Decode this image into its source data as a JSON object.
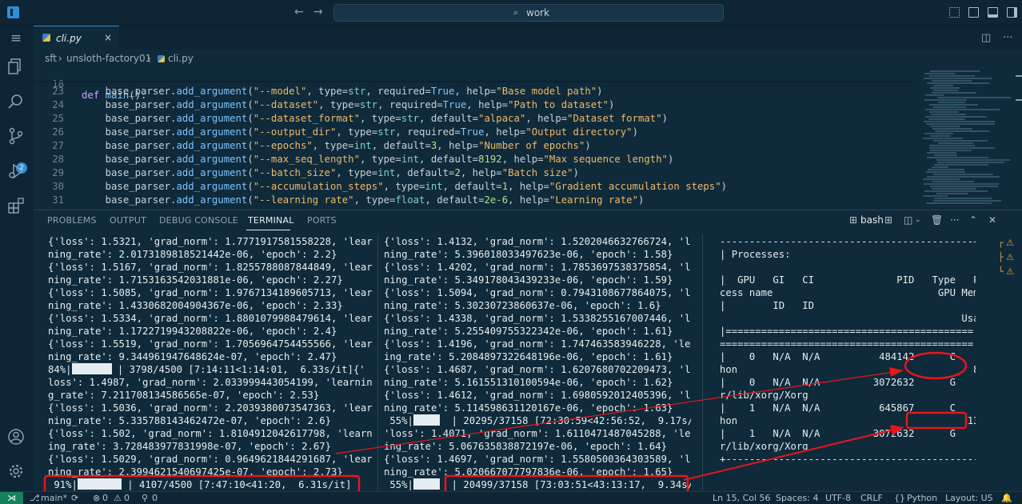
{
  "titlebar": {
    "search_text": "work",
    "back_glyph": "←",
    "forward_glyph": "→"
  },
  "activity": {
    "scm_badge": "2",
    "items": [
      "explorer-icon",
      "search-icon",
      "source-control-icon",
      "run-debug-icon",
      "extensions-icon",
      "account-icon",
      "settings-icon"
    ]
  },
  "editor": {
    "tab_label": "cli.py",
    "tab_close": "×",
    "breadcrumb": [
      "sft",
      "unsloth-factory01",
      "cli.py"
    ],
    "sticky_line": {
      "number": "18",
      "text": "def main():"
    },
    "lines": [
      {
        "n": "23",
        "arg": "--model",
        "type": "str",
        "mid": "required",
        "val": "True",
        "help": "Base model path"
      },
      {
        "n": "24",
        "arg": "--dataset",
        "type": "str",
        "mid": "required",
        "val": "True",
        "help": "Path to dataset"
      },
      {
        "n": "25",
        "arg": "--dataset_format",
        "type": "str",
        "mid": "default",
        "val": "\"alpaca\"",
        "help": "Dataset format"
      },
      {
        "n": "26",
        "arg": "--output_dir",
        "type": "str",
        "mid": "required",
        "val": "True",
        "help": "Output directory"
      },
      {
        "n": "27",
        "arg": "--epochs",
        "type": "int",
        "mid": "default",
        "val": "3",
        "help": "Number of epochs"
      },
      {
        "n": "28",
        "arg": "--max_seq_length",
        "type": "int",
        "mid": "default",
        "val": "8192",
        "help": "Max sequence length"
      },
      {
        "n": "29",
        "arg": "--batch_size",
        "type": "int",
        "mid": "default",
        "val": "2",
        "help": "Batch size"
      },
      {
        "n": "30",
        "arg": "--accumulation_steps",
        "type": "int",
        "mid": "default",
        "val": "1",
        "help": "Gradient accumulation steps"
      },
      {
        "n": "31",
        "arg": "--learning rate",
        "type": "float",
        "mid": "default",
        "val": "2e-6",
        "help": "Learning rate"
      }
    ]
  },
  "panel": {
    "tabs": [
      "PROBLEMS",
      "OUTPUT",
      "DEBUG CONSOLE",
      "TERMINAL",
      "PORTS"
    ],
    "active_tab": "TERMINAL",
    "shell": "bash",
    "terminal1": {
      "lines": [
        "{'loss': 1.5321, 'grad_norm': 1.7771917581558228, 'lear",
        "ning_rate': 2.0173189818521442e-06, 'epoch': 2.2}",
        "{'loss': 1.5167, 'grad_norm': 1.8255788087844849, 'lear",
        "ning_rate': 1.7153163542031881e-06, 'epoch': 2.27}",
        "{'loss': 1.5085, 'grad_norm': 1.9767134189605713, 'lear",
        "ning_rate': 1.4330682004904367e-06, 'epoch': 2.33}",
        "{'loss': 1.5334, 'grad_norm': 1.8801079988479614, 'lear",
        "ning_rate': 1.1722719943208822e-06, 'epoch': 2.4}",
        "{'loss': 1.5519, 'grad_norm': 1.7056964754455566, 'lear",
        "ning_rate': 9.344961947648624e-07, 'epoch': 2.47}",
        "__P84__",
        "loss': 1.4987, 'grad_norm': 2.033999443054199, 'learnin",
        "g_rate': 7.211708134586565e-07, 'epoch': 2.53}",
        "{'loss': 1.5036, 'grad_norm': 2.2039380073547363, 'lear",
        "ning_rate': 5.335788143462472e-07, 'epoch': 2.6}",
        "{'loss': 1.502, 'grad_norm': 1.8104912042617798, 'learn",
        "ing_rate': 3.728483977831998e-07, 'epoch': 2.67}",
        "{'loss': 1.5029, 'grad_norm': 0.9649621844291687, 'lear",
        "ning_rate': 2.3994621540697425e-07, 'epoch': 2.73}",
        "__P91__"
      ],
      "progress_84": {
        "pct": "84%|",
        "fill": 0.84,
        "rest": " | 3798/4500 [7:14:11<1:14:01,  6.33s/it]{'"
      },
      "progress_91": {
        "pct": " 91%|",
        "fill": 0.91,
        "rest": " | 4107/4500 [7:47:10<41:20,  6.31s/it]"
      }
    },
    "terminal2": {
      "lines": [
        "{'loss': 1.4132, 'grad_norm': 1.5202046632766724, 'lear",
        "ning_rate': 5.396018033497623e-06, 'epoch': 1.58}",
        "{'loss': 1.4202, 'grad_norm': 1.7853697538375854, 'lear",
        "ning_rate': 5.349178043439233e-06, 'epoch': 1.59}",
        "{'loss': 1.5094, 'grad_norm': 0.7943108677864075, 'lear",
        "ning_rate': 5.30230723860637e-06, 'epoch': 1.6}",
        "{'loss': 1.4338, 'grad_norm': 1.5338255167007446, 'lear",
        "ning_rate': 5.255409755322342e-06, 'epoch': 1.61}",
        "{'loss': 1.4196, 'grad_norm': 1.747463583946228, 'learn",
        "ing_rate': 5.2084897322648196e-06, 'epoch': 1.61}",
        "{'loss': 1.4687, 'grad_norm': 1.6207680702209473, 'lear",
        "ning_rate': 5.161551310100594e-06, 'epoch': 1.62}",
        "{'loss': 1.4612, 'grad_norm': 1.6980592012405396, 'lear",
        "ning_rate': 5.114598631120167e-06, 'epoch': 1.63}",
        "__P55a__",
        "'loss': 1.4071, 'grad_norm': 1.6110471487045288, 'learn",
        "ing_rate': 5.067635838872197e-06, 'epoch': 1.64}",
        "{'loss': 1.4697, 'grad_norm': 1.5580500364303589, 'lear",
        "ning_rate': 5.020667077797836e-06, 'epoch': 1.65}",
        "__P55b__"
      ],
      "progress_55a": {
        "pct": " 55%|",
        "fill": 0.55,
        "rest": "  | 20295/37158 [72:30:59<42:56:52,  9.17s/it]{"
      },
      "progress_55b": {
        "pct": " 55%|",
        "fill": 0.55,
        "rest": "  | 20499/37158 [73:03:51<43:13:17,  9.34s/it]"
      }
    },
    "terminal3": {
      "lines": [
        "-------------------------------------------+",
        "| Processes:",
        "                                           |",
        "|  GPU   GI   CI              PID   Type   Pro",
        "cess name                            GPU Memory |",
        "|        ID   ID",
        "                                         Usage      |",
        "|==========================================",
        "===========================================|",
        "|    0   N/A  N/A          484142      C    pyt",
        "hon                                        8374MiB |",
        "|    0   N/A  N/A         3072632      G    /us",
        "r/lib/xorg/Xorg                              4MiB |",
        "|    1   N/A  N/A          645867      C    pyt",
        "hon                                       13838MiB |",
        "|    1   N/A  N/A         3072632      G    /us",
        "r/lib/xorg/Xorg                              4MiB |",
        "+-------------------------------------------+"
      ]
    }
  },
  "statusbar": {
    "remote": "⋊",
    "branch": "main*",
    "sync": "⟳",
    "errors": "0",
    "warnings": "0",
    "ports": "0",
    "position": "Ln 15, Col 56",
    "spaces": "Spaces: 4",
    "encoding": "UTF-8",
    "eol": "CRLF",
    "language": "Python",
    "layout": "Layout: US"
  },
  "colors": {
    "accent": "#2f8fd6",
    "annotation": "#e8161b",
    "background": "#0f2a3a"
  }
}
